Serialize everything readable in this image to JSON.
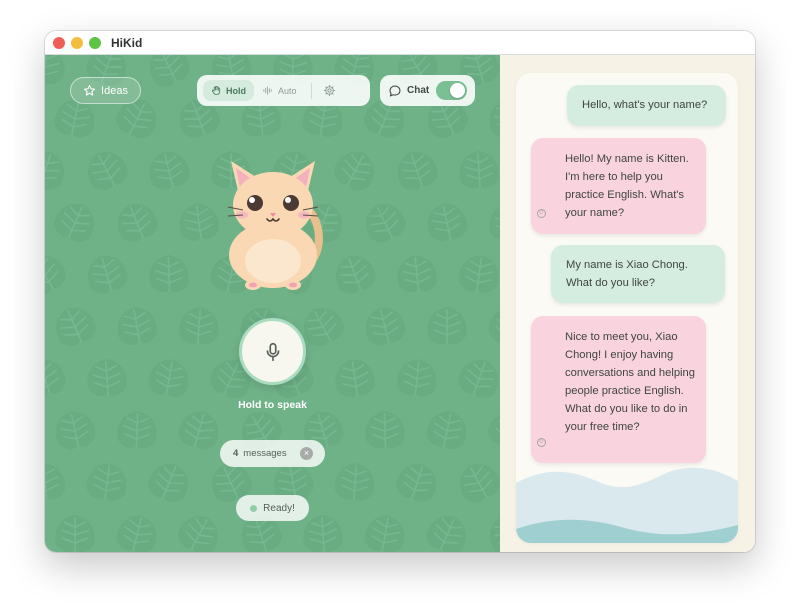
{
  "window": {
    "title": "HiKid"
  },
  "toolbar": {
    "ideas_label": "Ideas",
    "modes": [
      {
        "label": "Hold",
        "active": true
      },
      {
        "label": "Auto",
        "active": false
      }
    ],
    "chat_label": "Chat",
    "chat_toggle_on": true
  },
  "voice": {
    "hold_label": "Hold to speak"
  },
  "messages_pill": {
    "count": "4",
    "label": "messages"
  },
  "status": {
    "text": "Ready!"
  },
  "chat": {
    "messages": [
      {
        "role": "user",
        "text": "Hello, what's your name?"
      },
      {
        "role": "bot",
        "text": "Hello! My name is Kitten. I'm here to help you practice English. What's your name?"
      },
      {
        "role": "user",
        "text": "My name is Xiao Chong. What do you like?"
      },
      {
        "role": "bot",
        "text": "Nice to meet you, Xiao Chong! I enjoy having conversations and helping people practice English. What do you like to do in your free time?"
      }
    ]
  },
  "colors": {
    "panel_green": "#70b288",
    "bot_bubble": "#f9d3de",
    "user_bubble": "#d5ede0",
    "background": "#f6f3e6"
  },
  "icons": [
    "star-icon",
    "hand-icon",
    "sound-wave-icon",
    "gear-icon",
    "chat-bubble-icon",
    "microphone-icon",
    "close-icon",
    "bot-face-icon"
  ]
}
